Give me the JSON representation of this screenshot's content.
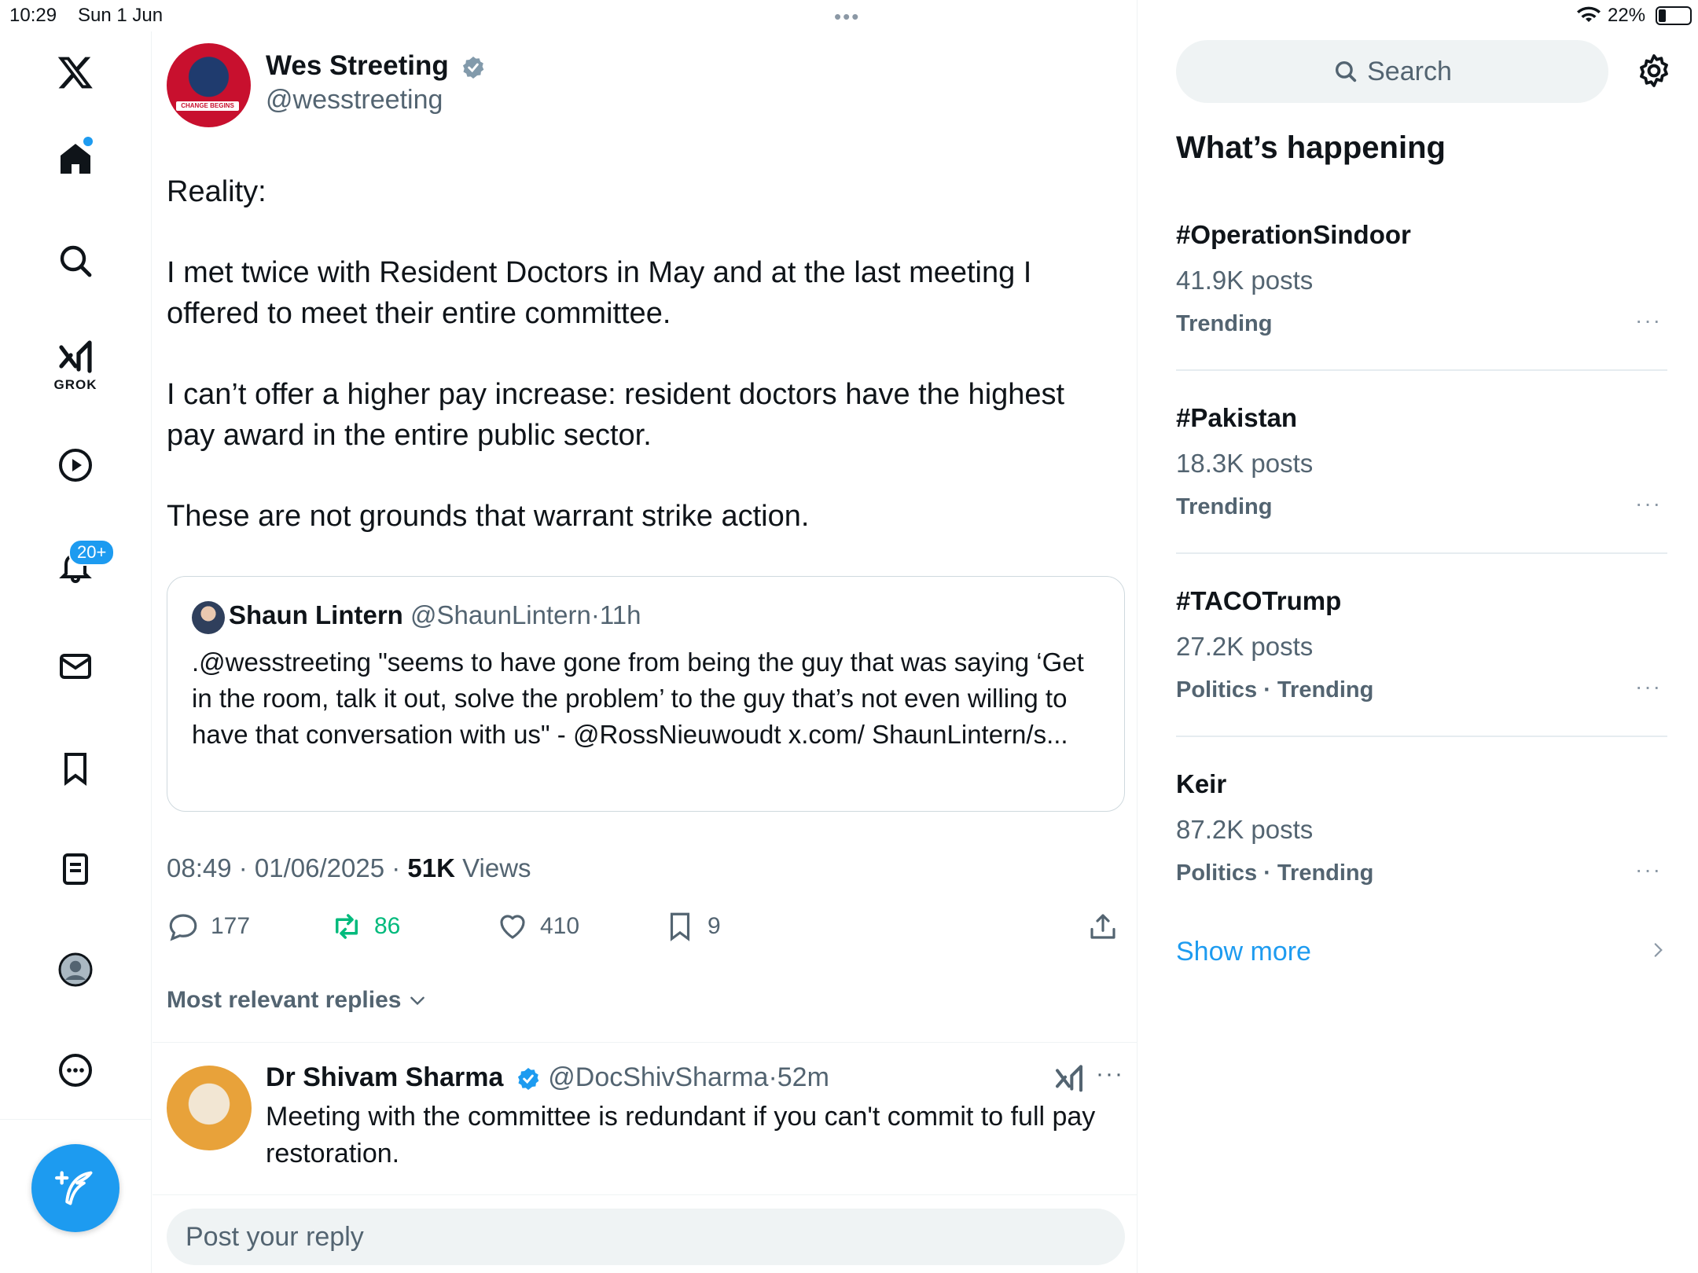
{
  "status_bar": {
    "time": "10:29",
    "date": "Sun 1 Jun",
    "multitask_dots": "•••",
    "battery": "22%"
  },
  "sidebar": {
    "grok_label": "GROK",
    "notifications_badge": "20+",
    "icons": [
      "x-logo-icon",
      "home-icon",
      "search-icon",
      "grok-icon",
      "video-icon",
      "notifications-icon",
      "messages-icon",
      "bookmarks-icon",
      "lists-icon",
      "profile-icon",
      "more-icon",
      "compose-icon"
    ]
  },
  "tweet": {
    "author_name": "Wes Streeting",
    "author_handle": "@wesstreeting",
    "avatar_banner_text": "CHANGE BEGINS",
    "paragraphs": [
      "Reality:",
      "I met twice with Resident Doctors in May and at the last meeting I offered to meet their entire committee.",
      "I can’t offer a higher pay increase: resident doctors have the highest pay award in the entire public sector.",
      "These are not grounds that warrant strike action."
    ],
    "quote": {
      "name": "Shaun Lintern",
      "handle": "@ShaunLintern",
      "time": "11h",
      "text": ".@wesstreeting \"seems to have gone from being the guy that was saying ‘Get in the room, talk it out, solve the problem’ to the guy that’s not even willing to have that conversation with us\" - @RossNieuwoudt x.com/ ShaunLintern/s..."
    },
    "timestamp": "08:49 · 01/06/2025 · ",
    "views_count": "51K",
    "views_label": " Views",
    "replies": "177",
    "reposts": "86",
    "likes": "410",
    "bookmarks": "9"
  },
  "replies_section": {
    "sort_label": "Most relevant replies",
    "reply": {
      "name": "Dr Shivam Sharma",
      "handle": "@DocShivSharma",
      "time": "52m",
      "text": "Meeting with the committee is redundant if you can't commit to full pay restoration."
    },
    "input_placeholder": "Post your reply"
  },
  "right": {
    "search_placeholder": "Search",
    "heading": "What’s happening",
    "trends": [
      {
        "name": "#OperationSindoor",
        "count": "41.9K posts",
        "context": "Trending"
      },
      {
        "name": "#Pakistan",
        "count": "18.3K posts",
        "context": "Trending"
      },
      {
        "name": "#TACOTrump",
        "count": "27.2K posts",
        "context": "Politics · Trending"
      },
      {
        "name": "Keir",
        "count": "87.2K posts",
        "context": "Politics · Trending"
      }
    ],
    "show_more": "Show more"
  },
  "colors": {
    "accent": "#1d9bf0",
    "repost_green": "#00ba7c",
    "secondary_text": "#536471"
  }
}
